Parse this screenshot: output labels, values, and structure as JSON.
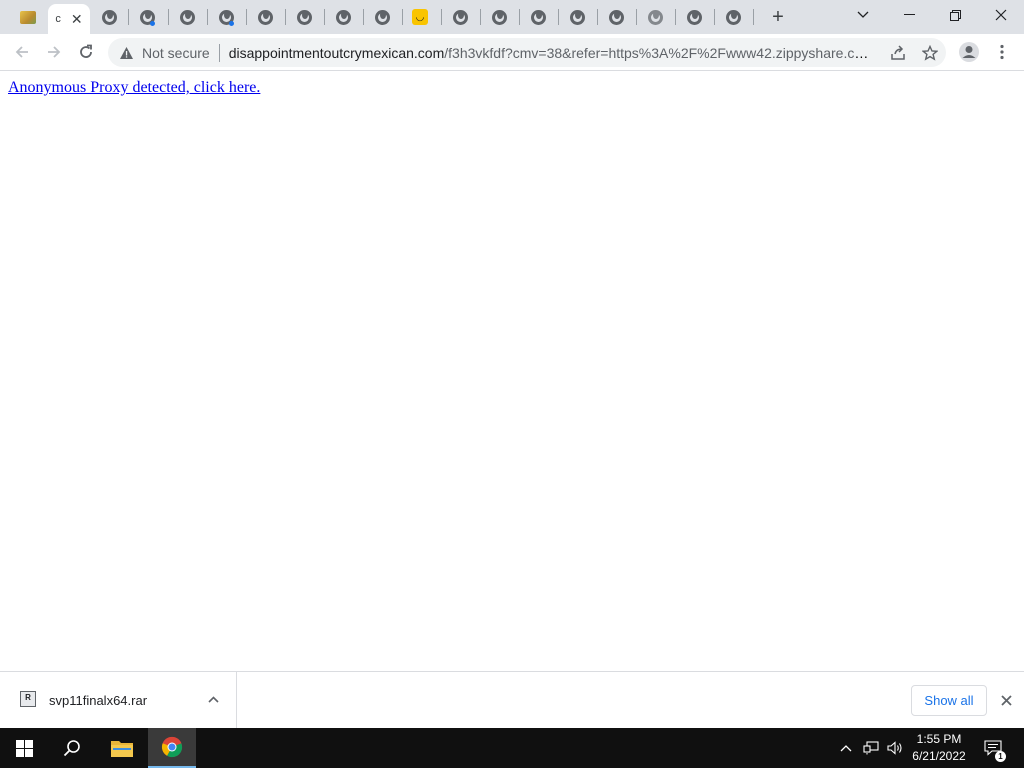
{
  "browser": {
    "tabs": [
      {
        "favicon": "image-favicon-icon",
        "active": false
      },
      {
        "label": "c",
        "favicon": "none",
        "active": true
      },
      {
        "favicon": "globe-icon"
      },
      {
        "favicon": "globe-icon",
        "loading_dot": true
      },
      {
        "favicon": "globe-icon"
      },
      {
        "favicon": "globe-icon",
        "loading_dot": true
      },
      {
        "favicon": "globe-icon"
      },
      {
        "favicon": "globe-icon"
      },
      {
        "favicon": "globe-icon"
      },
      {
        "favicon": "globe-icon"
      },
      {
        "favicon": "smiley-yellow-icon"
      },
      {
        "favicon": "globe-icon"
      },
      {
        "favicon": "globe-icon"
      },
      {
        "favicon": "globe-icon"
      },
      {
        "favicon": "globe-icon"
      },
      {
        "favicon": "globe-icon"
      },
      {
        "favicon": "globe-icon"
      },
      {
        "favicon": "globe-icon"
      },
      {
        "favicon": "globe-icon"
      }
    ],
    "omnibox": {
      "security_label": "Not secure",
      "url_host": "disappointmentoutcrymexican.com",
      "url_path": "/f3h3vkfdf?cmv=38&refer=https%3A%2F%2Fwww42.zippyshare.co..."
    }
  },
  "page": {
    "link_text": "Anonymous Proxy detected, click here."
  },
  "downloads": {
    "file_name": "svp11finalx64.rar",
    "show_all_label": "Show all"
  },
  "taskbar": {
    "time": "1:55 PM",
    "date": "6/21/2022",
    "notification_count": "1"
  },
  "colors": {
    "link": "#0000ee",
    "accent": "#1a73e8",
    "tabstrip_bg": "#dee1e6",
    "taskbar_bg": "#101010"
  }
}
